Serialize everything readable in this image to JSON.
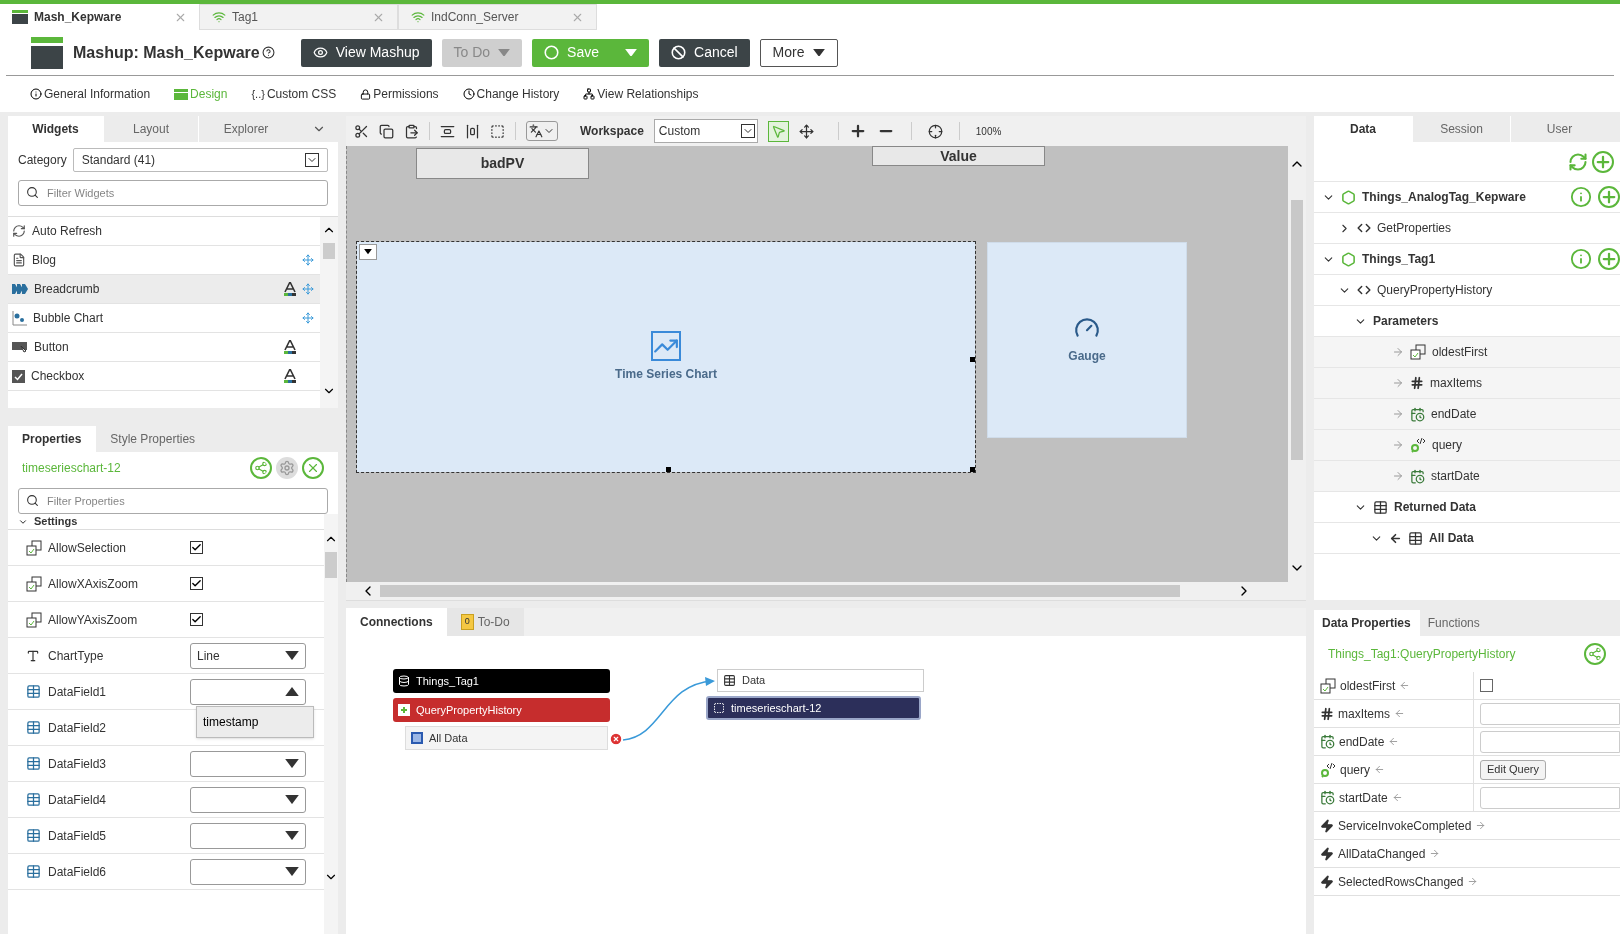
{
  "doc_tabs": [
    {
      "label": "Mash_Kepware",
      "kind": "mashup",
      "selected": true
    },
    {
      "label": "Tag1",
      "kind": "thing",
      "selected": false
    },
    {
      "label": "IndConn_Server",
      "kind": "thing",
      "selected": false
    }
  ],
  "header": {
    "title": "Mashup: Mash_Kepware",
    "buttons": [
      {
        "label": "View Mashup",
        "kind": "dark"
      },
      {
        "label": "To Do",
        "kind": "disabled"
      },
      {
        "label": "Save",
        "kind": "green"
      },
      {
        "label": "Cancel",
        "kind": "dark"
      },
      {
        "label": "More",
        "kind": "outline"
      }
    ]
  },
  "nav": [
    {
      "label": "General Information",
      "selected": false
    },
    {
      "label": "Design",
      "selected": true
    },
    {
      "label": "Custom CSS",
      "glyph": "{..}",
      "selected": false
    },
    {
      "label": "Permissions",
      "selected": false
    },
    {
      "label": "Change History",
      "selected": false
    },
    {
      "label": "View Relationships",
      "selected": false
    }
  ],
  "widgets_panel": {
    "tabs": [
      {
        "label": "Widgets",
        "selected": true
      },
      {
        "label": "Layout",
        "selected": false
      },
      {
        "label": "Explorer",
        "selected": false
      }
    ],
    "category_label": "Category",
    "category": "Standard (41)",
    "filter_placeholder": "Filter Widgets",
    "widgets": [
      {
        "label": "Auto Refresh",
        "selected": false,
        "styled": false,
        "movable": false
      },
      {
        "label": "Blog",
        "selected": false,
        "styled": false,
        "movable": true
      },
      {
        "label": "Breadcrumb",
        "selected": true,
        "styled": true,
        "movable": true
      },
      {
        "label": "Bubble Chart",
        "selected": false,
        "styled": false,
        "movable": true
      },
      {
        "label": "Button",
        "selected": false,
        "styled": true,
        "movable": false
      },
      {
        "label": "Checkbox",
        "selected": false,
        "styled": true,
        "movable": false
      }
    ]
  },
  "properties_panel": {
    "tabs": [
      {
        "label": "Properties",
        "selected": true
      },
      {
        "label": "Style Properties",
        "selected": false
      }
    ],
    "widget_id": "timeserieschart-12",
    "filter_placeholder": "Filter Properties",
    "section": "Settings",
    "rows": [
      {
        "label": "AllowSelection",
        "kind": "flag",
        "checked": true
      },
      {
        "label": "AllowXAxisZoom",
        "kind": "flag",
        "checked": true
      },
      {
        "label": "AllowYAxisZoom",
        "kind": "flag",
        "checked": true
      },
      {
        "label": "ChartType",
        "kind": "choice",
        "value": "Line",
        "open": false
      },
      {
        "label": "DataField1",
        "kind": "field",
        "open": true,
        "options": [
          "timestamp"
        ]
      },
      {
        "label": "DataField2",
        "kind": "field",
        "open": false
      },
      {
        "label": "DataField3",
        "kind": "field",
        "open": false
      },
      {
        "label": "DataField4",
        "kind": "field",
        "open": false
      },
      {
        "label": "DataField5",
        "kind": "field",
        "open": false
      },
      {
        "label": "DataField6",
        "kind": "field",
        "open": false
      }
    ]
  },
  "toolbar": {
    "workspace_label": "Workspace",
    "workspace": "Custom",
    "zoom": "100%"
  },
  "canvas": {
    "widgets": [
      {
        "label": "badPV",
        "kind": "label",
        "selected": false
      },
      {
        "label": "Value",
        "kind": "header",
        "selected": false
      },
      {
        "label": "Time Series Chart",
        "kind": "chart",
        "selected": true
      },
      {
        "label": "Gauge",
        "kind": "gauge",
        "selected": false
      }
    ]
  },
  "connections": {
    "tabs": [
      {
        "label": "Connections",
        "selected": true,
        "kind": "plain"
      },
      {
        "label": "To-Do",
        "selected": false,
        "kind": "todo",
        "badge": "0"
      }
    ],
    "source": {
      "thing": "Things_Tag1",
      "service": "QueryPropertyHistory",
      "output": "All Data"
    },
    "target": {
      "property": "Data",
      "widget": "timeserieschart-12"
    }
  },
  "data_panel": {
    "tabs": [
      {
        "label": "Data",
        "selected": true
      },
      {
        "label": "Session",
        "selected": false
      },
      {
        "label": "User",
        "selected": false
      }
    ],
    "tree": [
      {
        "label": "Things_AnalogTag_Kepware",
        "kind": "thing",
        "expanded": true,
        "children": [
          {
            "label": "GetProperties",
            "kind": "service",
            "expanded": false
          }
        ]
      },
      {
        "label": "Things_Tag1",
        "kind": "thing",
        "expanded": true,
        "children": [
          {
            "label": "QueryPropertyHistory",
            "kind": "service",
            "expanded": true,
            "children": [
              {
                "label": "Parameters",
                "kind": "group",
                "expanded": true,
                "children": [
                  {
                    "label": "oldestFirst",
                    "kind": "boolean"
                  },
                  {
                    "label": "maxItems",
                    "kind": "number"
                  },
                  {
                    "label": "endDate",
                    "kind": "datetime"
                  },
                  {
                    "label": "query",
                    "kind": "query"
                  },
                  {
                    "label": "startDate",
                    "kind": "datetime"
                  }
                ]
              },
              {
                "label": "Returned Data",
                "kind": "table",
                "expanded": true,
                "children": [
                  {
                    "label": "All Data",
                    "kind": "output",
                    "expanded": true
                  }
                ]
              }
            ]
          }
        ]
      }
    ]
  },
  "data_properties": {
    "tabs": [
      {
        "label": "Data Properties",
        "selected": true
      },
      {
        "label": "Functions",
        "selected": false
      }
    ],
    "title": "Things_Tag1:QueryPropertyHistory",
    "rows": [
      {
        "label": "oldestFirst",
        "kind": "boolean",
        "checked": false
      },
      {
        "label": "maxItems",
        "kind": "number"
      },
      {
        "label": "endDate",
        "kind": "datetime"
      },
      {
        "label": "query",
        "kind": "query",
        "button": "Edit Query"
      },
      {
        "label": "startDate",
        "kind": "datetime"
      },
      {
        "label": "ServiceInvokeCompleted",
        "kind": "event"
      },
      {
        "label": "AllDataChanged",
        "kind": "event"
      },
      {
        "label": "SelectedRowsChanged",
        "kind": "event"
      }
    ]
  }
}
